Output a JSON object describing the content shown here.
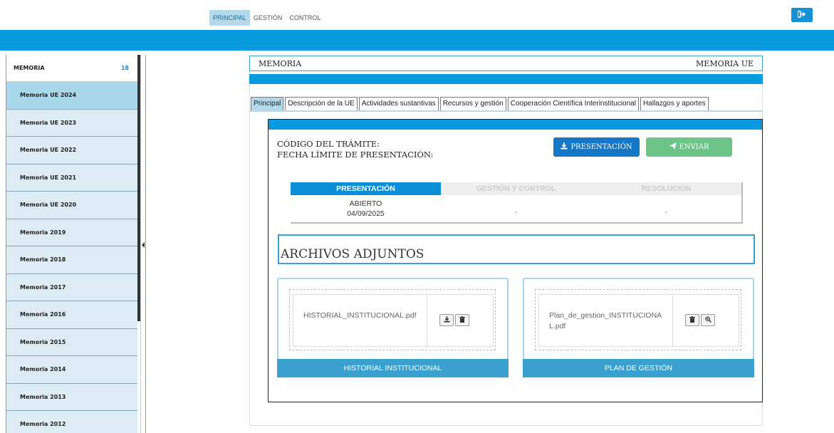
{
  "topnav": {
    "items": [
      "PRINCIPAL",
      "GESTIÓN",
      "CONTROL"
    ],
    "logout_icon": "sign-out-icon"
  },
  "sidebar": {
    "header": "MEMORIA",
    "count": "18",
    "items": [
      "Memoria UE 2024",
      "Memoria UE 2023",
      "Memoria UE 2022",
      "Memoria UE 2021",
      "Memoria UE 2020",
      "Memoria 2019",
      "Memoria 2018",
      "Memoria 2017",
      "Memoria 2016",
      "Memoria 2015",
      "Memoria 2014",
      "Memoria 2013",
      "Memoria 2012"
    ]
  },
  "header": {
    "left": "MEMORIA",
    "right": "MEMORIA UE"
  },
  "tabs": [
    "Principal",
    "Descripción de la UE",
    "Actividades sustantivas",
    "Recursos y gestión",
    "Cooperación Científica Interinstitucional",
    "Hallazgos y aportes"
  ],
  "tramite": {
    "codigo_label": "CÓDIGO DEL TRÁMITE:",
    "fecha_label": "FECHA LÍMITE DE PRESENTACIÓN:",
    "btn_presentacion": "PRESENTACIÓN",
    "btn_enviar": "ENVIAR"
  },
  "status": {
    "headers": [
      "PRESENTACIÓN",
      "GESTIÓN Y CONTROL",
      "RESOLUCIÓN"
    ],
    "presentacion_state": "ABIERTO",
    "presentacion_date": "04/09/2025",
    "gestion_value": "-",
    "resolucion_value": "-"
  },
  "archivos": {
    "title": "ARCHIVOS ADJUNTOS",
    "cards": [
      {
        "filename": "HISTORIAL_INSTITUCIONAL.pdf",
        "footer": "HISTORIAL INSTITUCIONAL"
      },
      {
        "filename": "Plan_de_gestion_INSTITUCIONAL.pdf",
        "footer": "PLAN DE GESTIÓN"
      }
    ]
  },
  "colors": {
    "brand_blue": "#0a9ae0",
    "button_blue": "#1577c5",
    "button_green": "#6cc486",
    "sidebar_row": "#dcebf4",
    "sidebar_active": "#a9d7ec"
  }
}
